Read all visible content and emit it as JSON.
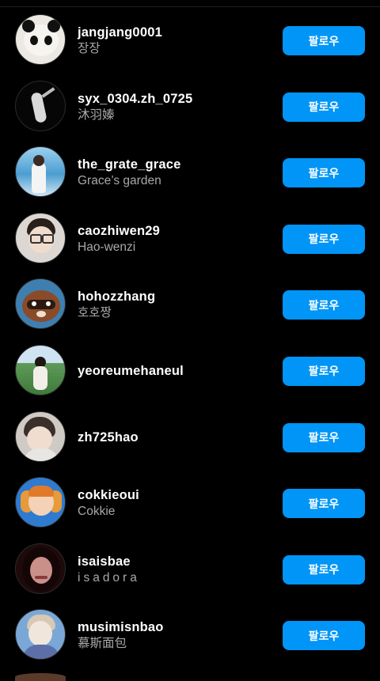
{
  "follow_label": "팔로우",
  "accounts": [
    {
      "username": "jangjang0001",
      "fullname": "장장",
      "avatar": "panda-plush-icon",
      "bg": "#e8e6e2",
      "fg": "#1a1a1a"
    },
    {
      "username": "syx_0304.zh_0725",
      "fullname": "沐羽嫀",
      "avatar": "dancer-silhouette-icon",
      "bg": "#0a0a0a",
      "fg": "#d9d9d9"
    },
    {
      "username": "the_grate_grace",
      "fullname": "Grace’s garden",
      "avatar": "person-seaside-icon",
      "bg": "#8fc3e6",
      "fg": "#f2f2f2"
    },
    {
      "username": "caozhiwen29",
      "fullname": "Hao-wenzi",
      "avatar": "person-glasses-icon",
      "bg": "#d8d4d0",
      "fg": "#3a2a25"
    },
    {
      "username": "hohozzhang",
      "fullname": "호호짱",
      "avatar": "cartoon-raccoon-icon",
      "bg": "#3f7fb0",
      "fg": "#8a4b2a"
    },
    {
      "username": "yeoreumehaneul",
      "fullname": "",
      "avatar": "person-field-icon",
      "bg": "#6a9a6a",
      "fg": "#2a2a2a"
    },
    {
      "username": "zh725hao",
      "fullname": "",
      "avatar": "person-portrait-icon",
      "bg": "#cfcac4",
      "fg": "#3a2f2a"
    },
    {
      "username": "cokkieoui",
      "fullname": "Cokkie",
      "avatar": "kid-orange-icon",
      "bg": "#2e7bd0",
      "fg": "#e79a3a"
    },
    {
      "username": "isaisbae",
      "fullname": "isadora",
      "avatar": "person-dark-hair-icon",
      "bg": "#2a0e0e",
      "fg": "#c9908a"
    },
    {
      "username": "musimisnbao",
      "fullname": "慕斯面包",
      "avatar": "person-blue-icon",
      "bg": "#7aa8d6",
      "fg": "#f0e6dc"
    }
  ]
}
